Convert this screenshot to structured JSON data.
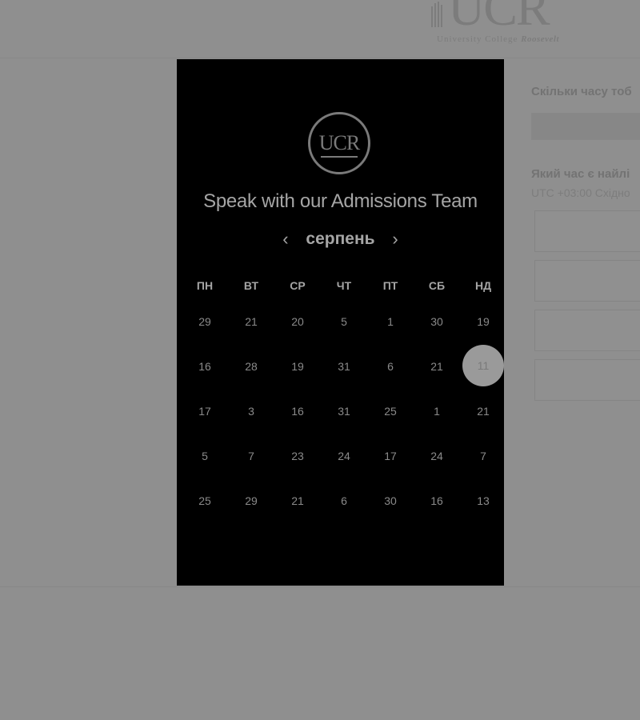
{
  "header": {
    "logo_mark": "UCR",
    "logo_subtitle": "University College",
    "logo_subtitle_bold": "Roosevelt"
  },
  "right_panel": {
    "duration_question": "Скільки часу тоб",
    "time_question": "Який час є найлі",
    "timezone": "UTC +03:00 Східно"
  },
  "modal": {
    "logo_text": "UCR",
    "title": "Speak with our Admissions Team",
    "month": "серпень",
    "prev_arrow": "‹",
    "next_arrow": "›",
    "weekdays": [
      "ПН",
      "ВТ",
      "СР",
      "ЧТ",
      "ПТ",
      "СБ",
      "НД"
    ],
    "weeks": [
      [
        "29",
        "21",
        "20",
        "5",
        "1",
        "30",
        "19"
      ],
      [
        "16",
        "28",
        "19",
        "31",
        "6",
        "21",
        "11"
      ],
      [
        "17",
        "3",
        "16",
        "31",
        "25",
        "1",
        "21"
      ],
      [
        "5",
        "7",
        "23",
        "24",
        "17",
        "24",
        "7"
      ],
      [
        "25",
        "29",
        "21",
        "6",
        "30",
        "16",
        "13"
      ]
    ],
    "selected_day": "11"
  }
}
